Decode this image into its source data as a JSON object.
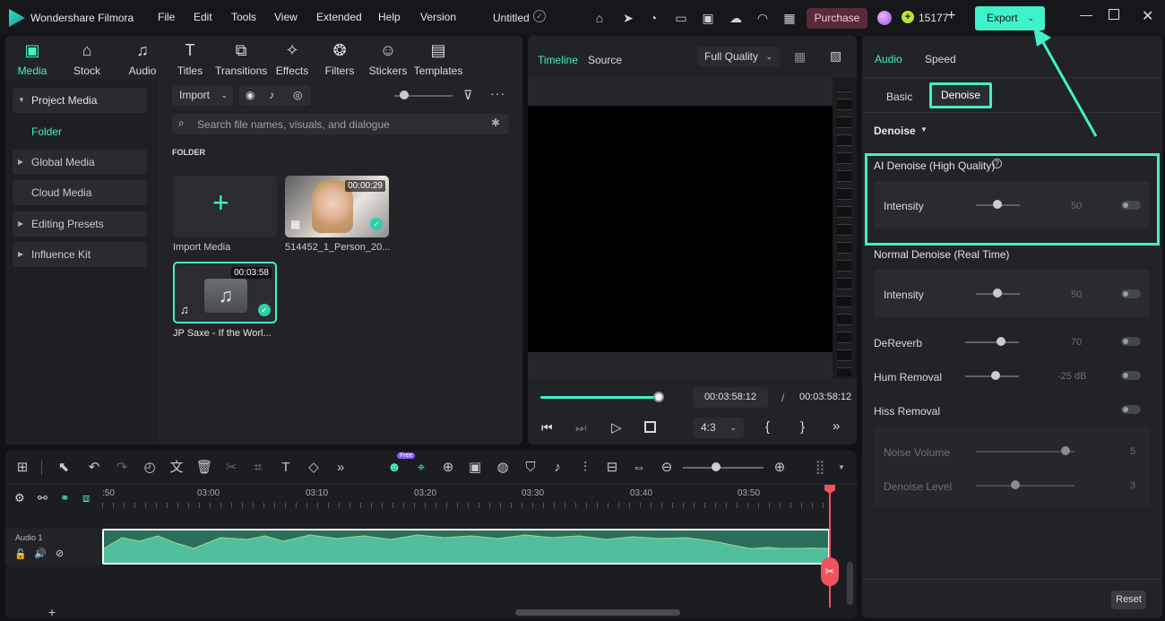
{
  "titlebar": {
    "app_name": "Wondershare Filmora",
    "menus": [
      "File",
      "Edit",
      "Tools",
      "View",
      "Extended",
      "Help",
      "Version"
    ],
    "project_title": "Untitled",
    "purchase_label": "Purchase",
    "credits": "15177",
    "export_label": "Export"
  },
  "tool_tabs": [
    "Media",
    "Stock Media",
    "Audio",
    "Titles",
    "Transitions",
    "Effects",
    "Filters",
    "Stickers",
    "Templates"
  ],
  "sidebar": {
    "items": [
      "Project Media",
      "Folder",
      "Global Media",
      "Cloud Media",
      "Editing Presets",
      "Influence Kit"
    ]
  },
  "media": {
    "import_label": "Import",
    "search_placeholder": "Search file names, visuals, and dialogue",
    "folder_header": "FOLDER",
    "import_media_label": "Import Media",
    "items": [
      {
        "name": "514452_1_Person_20...",
        "duration": "00:00:29"
      },
      {
        "name": "JP Saxe - If the Worl...",
        "duration": "00:03:58"
      }
    ]
  },
  "player": {
    "tab_timeline": "Timeline",
    "tab_source": "Source",
    "quality": "Full Quality",
    "current_time": "00:03:58:12",
    "separator": "/",
    "total_time": "00:03:58:12",
    "aspect": "4:3",
    "progress": 1.0
  },
  "right_panel": {
    "tab_audio": "Audio",
    "tab_speed": "Speed",
    "sub_basic": "Basic",
    "sub_denoise": "Denoise",
    "section_title": "Denoise",
    "ai_denoise_title": "AI Denoise (High Quality)",
    "ai_intensity_label": "Intensity",
    "ai_intensity_value": "50",
    "normal_denoise_title": "Normal Denoise (Real Time)",
    "normal_intensity_label": "Intensity",
    "normal_intensity_value": "50",
    "dereverb_label": "DeReverb",
    "dereverb_value": "70",
    "hum_label": "Hum Removal",
    "hum_value": "-25 dB",
    "hiss_label": "Hiss Removal",
    "noise_volume_label": "Noise Volume",
    "noise_volume_value": "5",
    "denoise_level_label": "Denoise Level",
    "denoise_level_value": "3",
    "reset_label": "Reset"
  },
  "timeline": {
    "free_badge": "Free",
    "ruler": [
      ":50",
      "03:00",
      "03:10",
      "03:20",
      "03:30",
      "03:40",
      "03:50"
    ],
    "track_label": "Audio 1"
  },
  "colors": {
    "accent": "#43f0c4",
    "purchase": "#5a2a3a",
    "playhead": "#f0535d",
    "waveform": "#3ea88a"
  }
}
